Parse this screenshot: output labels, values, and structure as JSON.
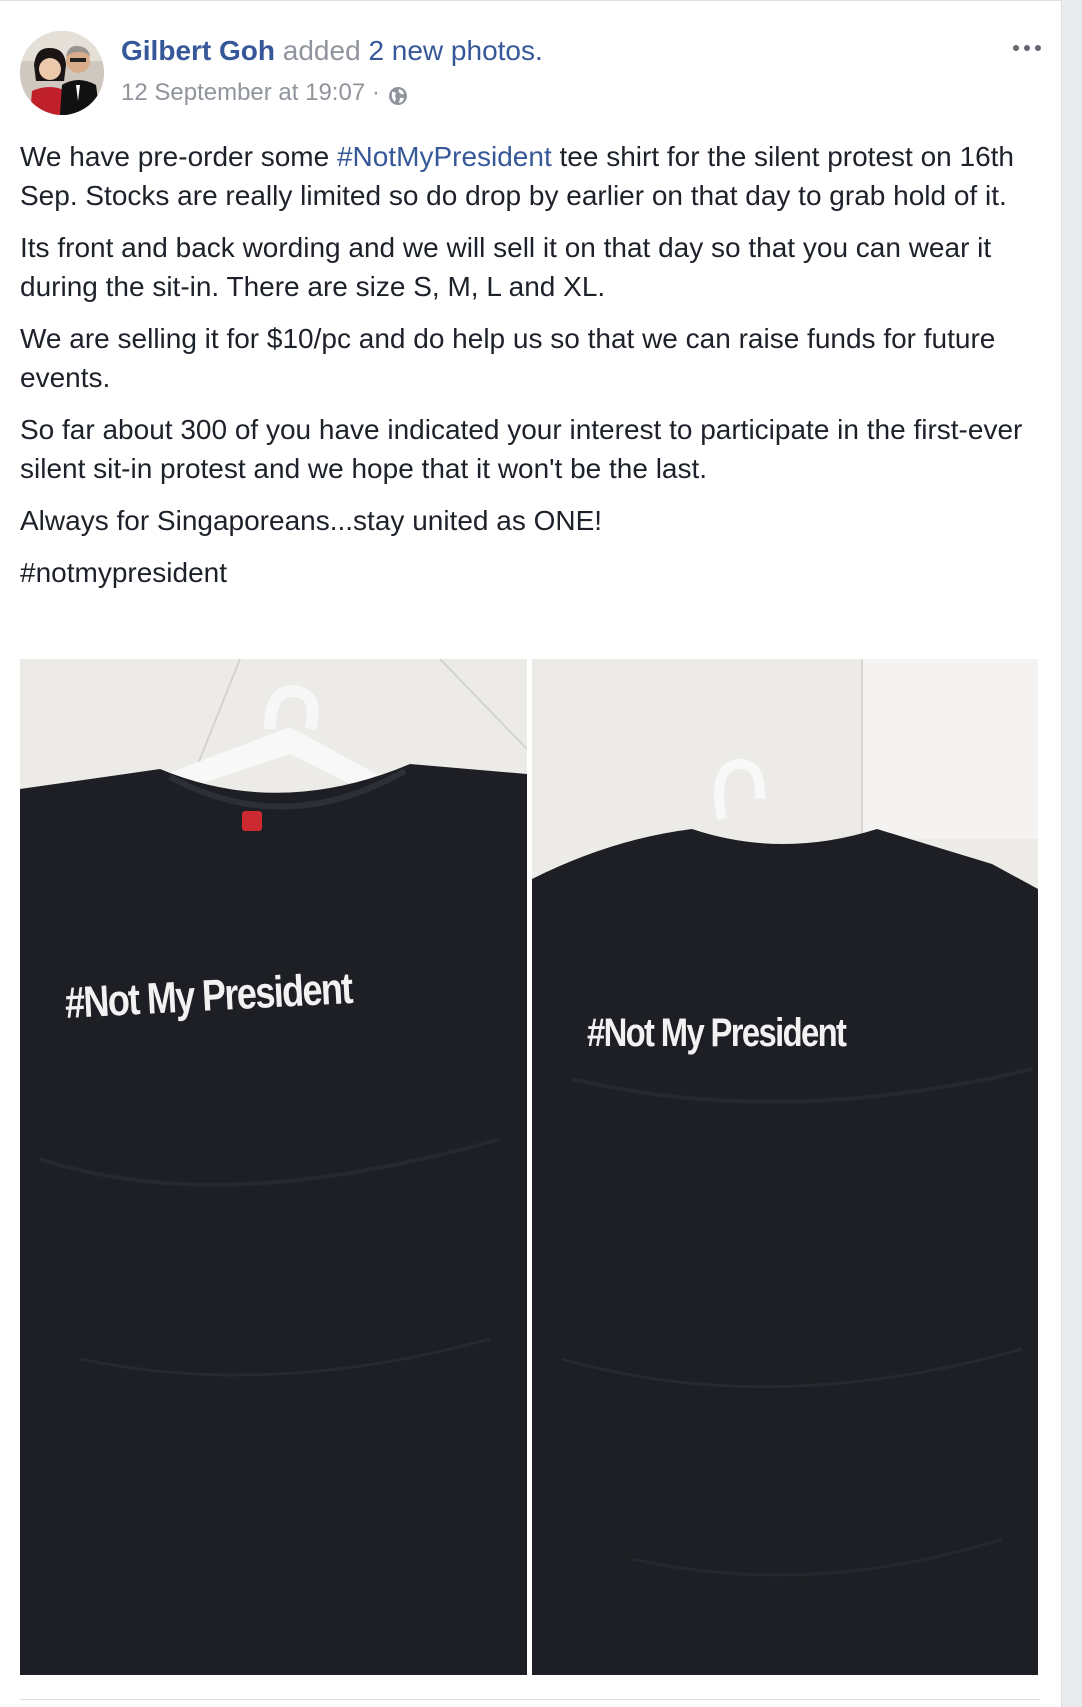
{
  "post": {
    "author": "Gilbert Goh",
    "action": "added",
    "photos_link": "2 new photos.",
    "timestamp": "12 September at 19:07 ·",
    "privacy_icon": "globe-icon",
    "more_icon": "more-options-icon",
    "paragraphs": {
      "p1_before": "We have pre-order some ",
      "p1_hashtag": "#NotMyPresident",
      "p1_after": " tee shirt for the silent protest on 16th Sep. Stocks are really limited so do drop by earlier on that day to grab hold of it.",
      "p2": "Its front and back wording and we will sell it on that day so that you can wear it during the sit-in. There are size S, M, L and XL.",
      "p3": "We are selling it for $10/pc and do help us so that we can raise funds for future events.",
      "p4": "So far about 300 of you have indicated your interest to participate in the first-ever silent sit-in protest and we hope that it won't be the last.",
      "p5": "Always for Singaporeans...stay united as ONE!",
      "p6": "#notmypresident"
    },
    "photos": {
      "front_text": "#Not My President",
      "back_text": "#Not My President"
    }
  },
  "colors": {
    "link": "#365899",
    "meta": "#90949c",
    "text": "#1d2129",
    "shirt": "#1d1f24"
  }
}
